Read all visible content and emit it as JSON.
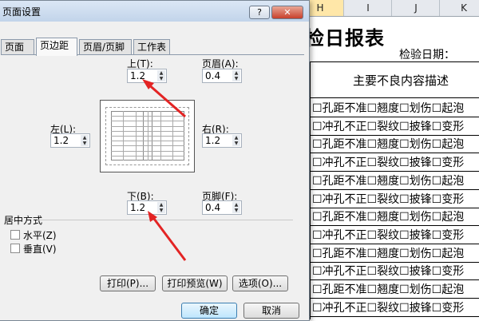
{
  "dialog": {
    "title": "页面设置",
    "help_label": "?",
    "close_label": "✕",
    "tabs": [
      {
        "label": "页面"
      },
      {
        "label": "页边距"
      },
      {
        "label": "页眉/页脚"
      },
      {
        "label": "工作表"
      }
    ],
    "margins": {
      "top_label": "上(T):",
      "top_value": "1.2",
      "header_label": "页眉(A):",
      "header_value": "0.4",
      "left_label": "左(L):",
      "left_value": "1.2",
      "right_label": "右(R):",
      "right_value": "1.2",
      "bottom_label": "下(B):",
      "bottom_value": "1.2",
      "footer_label": "页脚(F):",
      "footer_value": "0.4"
    },
    "center": {
      "section_label": "居中方式",
      "horizontal_label": "水平(Z)",
      "vertical_label": "垂直(V)"
    },
    "buttons": {
      "print": "打印(P)...",
      "preview": "打印预览(W)",
      "options": "选项(O)...",
      "ok": "确定",
      "cancel": "取消"
    }
  },
  "sheet": {
    "columns": [
      "H",
      "I",
      "J",
      "K"
    ],
    "title": "检日报表",
    "date_label": "检验日期：",
    "subtitle": "主要不良内容描述",
    "rows": [
      "☐孔距不准☐翘度☐划伤☐起泡",
      "☐冲孔不正☐裂纹☐披锋☐变形",
      "☐孔距不准☐翘度☐划伤☐起泡",
      "☐冲孔不正☐裂纹☐披锋☐变形",
      "☐孔距不准☐翘度☐划伤☐起泡",
      "☐冲孔不正☐裂纹☐披锋☐变形",
      "☐孔距不准☐翘度☐划伤☐起泡",
      "☐冲孔不正☐裂纹☐披锋☐变形",
      "☐孔距不准☐翘度☐划伤☐起泡",
      "☐冲孔不正☐裂纹☐披锋☐变形",
      "☐孔距不准☐翘度☐划伤☐起泡",
      "☐冲孔不正☐裂纹☐披锋☐变形",
      "☐孔距不准☐翘度☐划伤☐起泡"
    ]
  },
  "colors": {
    "annotation_arrow": "#e32424",
    "dialog_bg": "#f0f0f0",
    "close_button": "#c8402b"
  }
}
